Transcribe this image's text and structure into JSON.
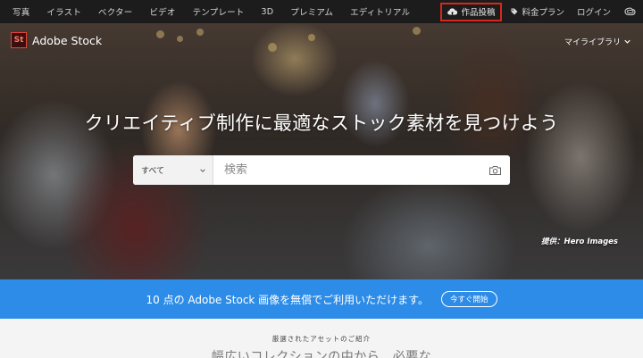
{
  "topnav": {
    "categories": [
      "写真",
      "イラスト",
      "ベクター",
      "ビデオ",
      "テンプレート",
      "3D",
      "プレミアム",
      "エディトリアル"
    ],
    "upload_label": "作品投稿",
    "pricing_label": "料金プラン",
    "login_label": "ログイン",
    "icons": {
      "upload": "cloud-upload-icon",
      "pricing": "tag-icon",
      "creative_cloud": "creative-cloud-icon"
    },
    "highlight_color": "#d9261c"
  },
  "hero": {
    "logo_text": "St",
    "brand_name": "Adobe Stock",
    "library_label": "マイライブラリ",
    "headline": "クリエイティブ制作に最適なストック素材を見つけよう",
    "search": {
      "scope_value": "すべて",
      "placeholder": "検索",
      "camera_icon": "camera-icon"
    },
    "credit": "提供：Hero Images"
  },
  "promo": {
    "text": "10 点の Adobe Stock 画像を無償でご利用いただけます。",
    "button_label": "今すぐ開始",
    "background": "#2d8ce8"
  },
  "featured": {
    "eyebrow": "厳選されたアセットのご紹介",
    "subtitle": "幅広いコレクションの中から、必要な"
  }
}
